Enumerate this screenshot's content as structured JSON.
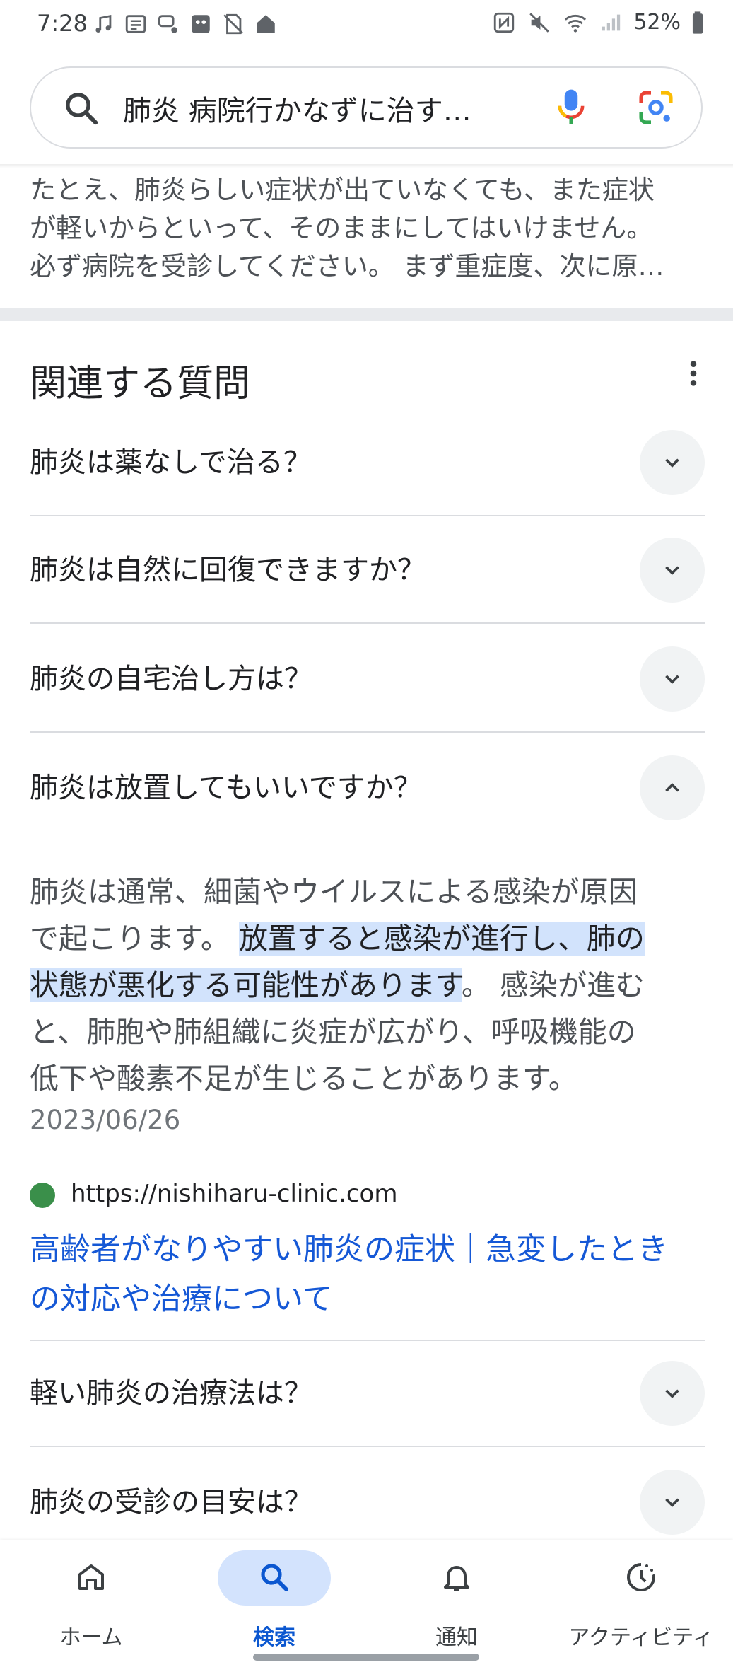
{
  "status_bar": {
    "time": "7:28",
    "battery": "52%"
  },
  "search": {
    "query": "肺炎 病院行かなずに治す…"
  },
  "snippet": {
    "lines": [
      "たとえ、肺炎らしい症状が出ていなくても、また症状",
      "が軽いからといって、そのままにしてはいけません。",
      "必ず病院を受診してください。 まず重症度、次に原…"
    ]
  },
  "related": {
    "title": "関連する質問",
    "questions": [
      "肺炎は薬なしで治る？",
      "肺炎は自然に回復できますか？",
      "肺炎の自宅治し方は？",
      "肺炎は放置してもいいですか？",
      "軽い肺炎の治療法は？",
      "肺炎の受診の目安は？"
    ],
    "answer": {
      "line1": "肺炎は通常、細菌やウイルスによる感染が原因",
      "line2_pre": "で起こります。 ",
      "line2_hl": "放置すると感染が進行し、肺の",
      "line3_hl": "状態が悪化する可能性があります",
      "line3_post": "。 感染が進む",
      "line4": "と、肺胞や肺組織に炎症が広がり、呼吸機能の",
      "line5": "低下や酸素不足が生じることがあります。",
      "date": "2023/06/26"
    },
    "source": {
      "url": "https://nishiharu-clinic.com",
      "title_line1": "高齢者がなりやすい肺炎の症状｜急変したとき",
      "title_line2": "の対応や治療について"
    }
  },
  "bottom_nav": {
    "items": [
      "ホーム",
      "検索",
      "通知",
      "アクティビティ"
    ],
    "active": "検索"
  },
  "colors": {
    "accent": "#0b57d0",
    "highlight": "#d2e3fc",
    "link": "#1558d6"
  }
}
